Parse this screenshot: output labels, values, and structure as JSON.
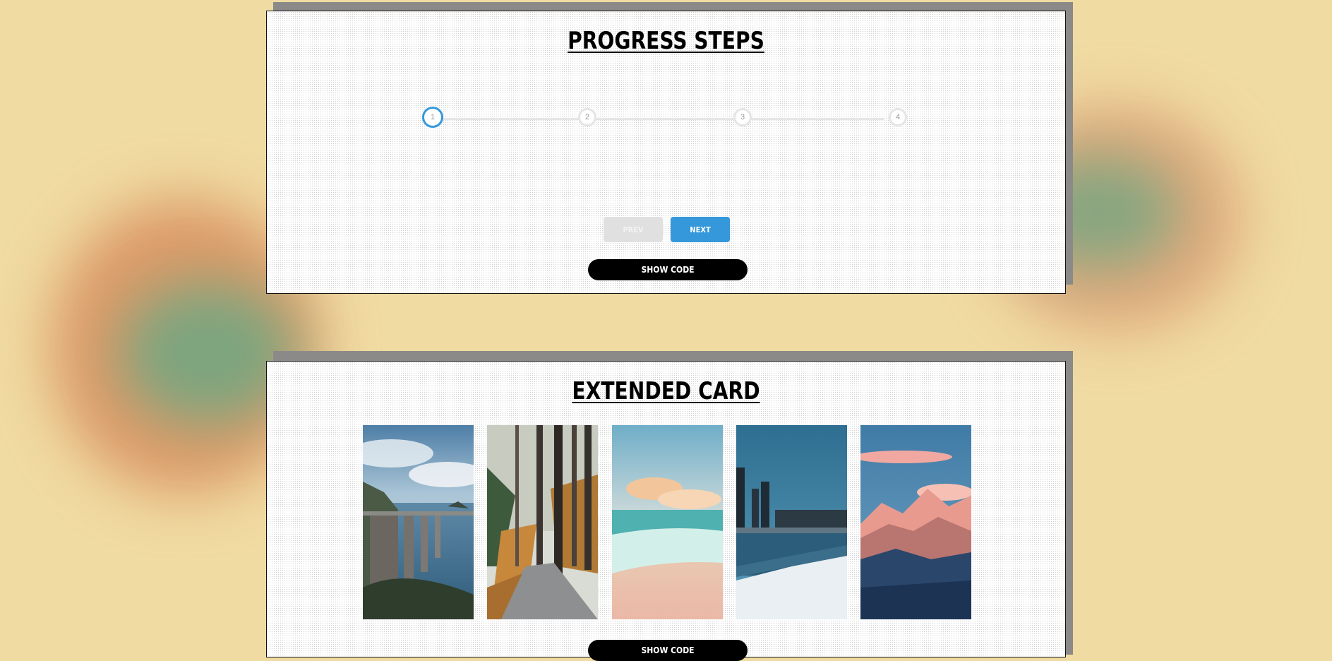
{
  "progress_steps": {
    "title": "Progress Steps",
    "steps": [
      "1",
      "2",
      "3",
      "4"
    ],
    "active_step": 1,
    "progress": 0,
    "prev_label": "Prev",
    "next_label": "Next",
    "show_code_label": "Show Code"
  },
  "extended_card": {
    "title": "Extended Card",
    "cards": [
      {
        "name": "coastal-bridge-image"
      },
      {
        "name": "forest-path-image"
      },
      {
        "name": "beach-sunset-image"
      },
      {
        "name": "city-waterfront-image"
      },
      {
        "name": "mountain-peaks-image"
      }
    ],
    "show_code_label": "Show Code"
  },
  "colors": {
    "background": "#f0dba2",
    "accent": "#3498db",
    "inactive": "#e0e0e0"
  }
}
